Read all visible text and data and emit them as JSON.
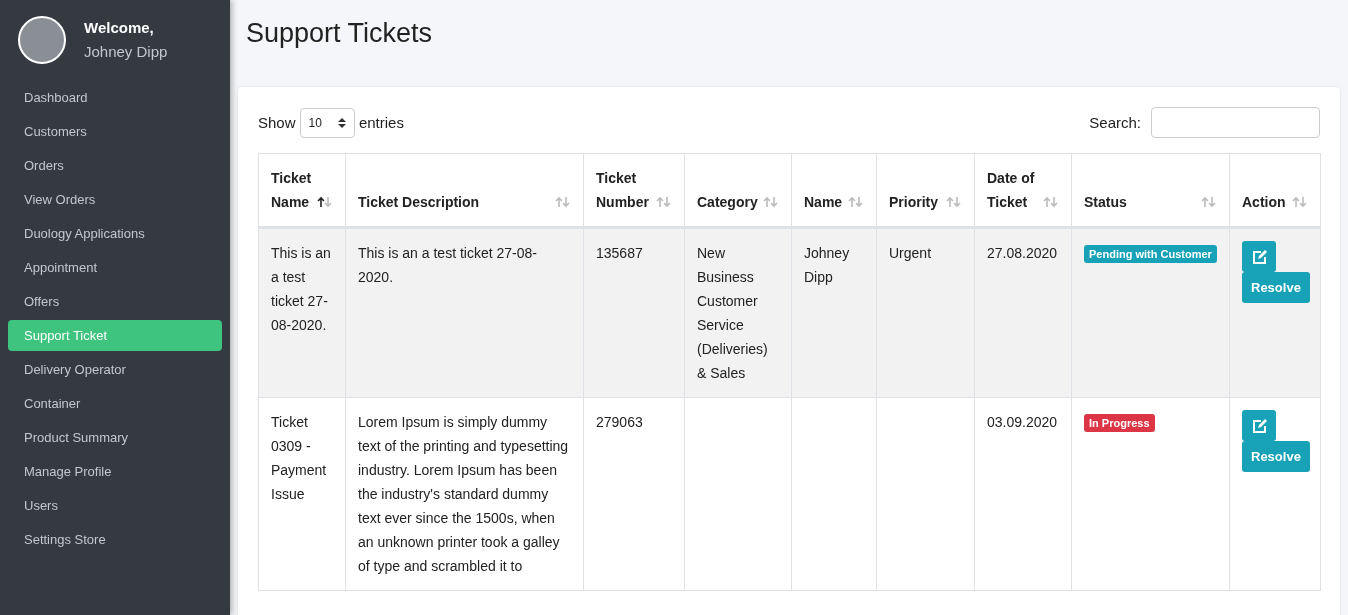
{
  "sidebar": {
    "greeting": "Welcome,",
    "user_name": "Johney Dipp",
    "items": [
      {
        "label": "Dashboard",
        "selected": false
      },
      {
        "label": "Customers",
        "selected": false
      },
      {
        "label": "Orders",
        "selected": false
      },
      {
        "label": "View Orders",
        "selected": false
      },
      {
        "label": "Duology Applications",
        "selected": false
      },
      {
        "label": "Appointment",
        "selected": false
      },
      {
        "label": "Offers",
        "selected": false
      },
      {
        "label": "Support Ticket",
        "selected": true
      },
      {
        "label": "Delivery Operator",
        "selected": false
      },
      {
        "label": "Container",
        "selected": false
      },
      {
        "label": "Product Summary",
        "selected": false
      },
      {
        "label": "Manage Profile",
        "selected": false
      },
      {
        "label": "Users",
        "selected": false
      },
      {
        "label": "Settings Store",
        "selected": false
      }
    ]
  },
  "page_title": "Support Tickets",
  "table_controls": {
    "show_label": "Show",
    "page_size": "10",
    "entries_label": "entries",
    "search_label": "Search:"
  },
  "table": {
    "columns": [
      {
        "label": "Ticket Name",
        "sorted": true
      },
      {
        "label": "Ticket Description",
        "sorted": false
      },
      {
        "label": "Ticket Number",
        "sorted": false
      },
      {
        "label": "Category",
        "sorted": false
      },
      {
        "label": "Name",
        "sorted": false
      },
      {
        "label": "Priority",
        "sorted": false
      },
      {
        "label": "Date of Ticket",
        "sorted": false
      },
      {
        "label": "Status",
        "sorted": false
      },
      {
        "label": "Action",
        "sorted": false
      }
    ],
    "rows": [
      {
        "ticket_name": "This is an a test ticket 27-08-2020.",
        "description": "This is an a test ticket 27-08-2020.",
        "number": "135687",
        "category": "New Business Customer Service (Deliveries) & Sales",
        "name": "Johney Dipp",
        "priority": "Urgent",
        "date": "27.08.2020",
        "status": {
          "label": "Pending with Customer",
          "color": "#17a2b8"
        },
        "resolve_label": "Resolve"
      },
      {
        "ticket_name": "Ticket 0309 - Payment Issue",
        "description": "Lorem Ipsum is simply dummy text of the printing and typesetting industry. Lorem Ipsum has been the industry's standard dummy text ever since the 1500s, when an unknown printer took a galley of type and scrambled it to",
        "number": "279063",
        "category": "",
        "name": "",
        "priority": "",
        "date": "03.09.2020",
        "status": {
          "label": "In Progress",
          "color": "#dc3545"
        },
        "resolve_label": "Resolve"
      }
    ]
  }
}
